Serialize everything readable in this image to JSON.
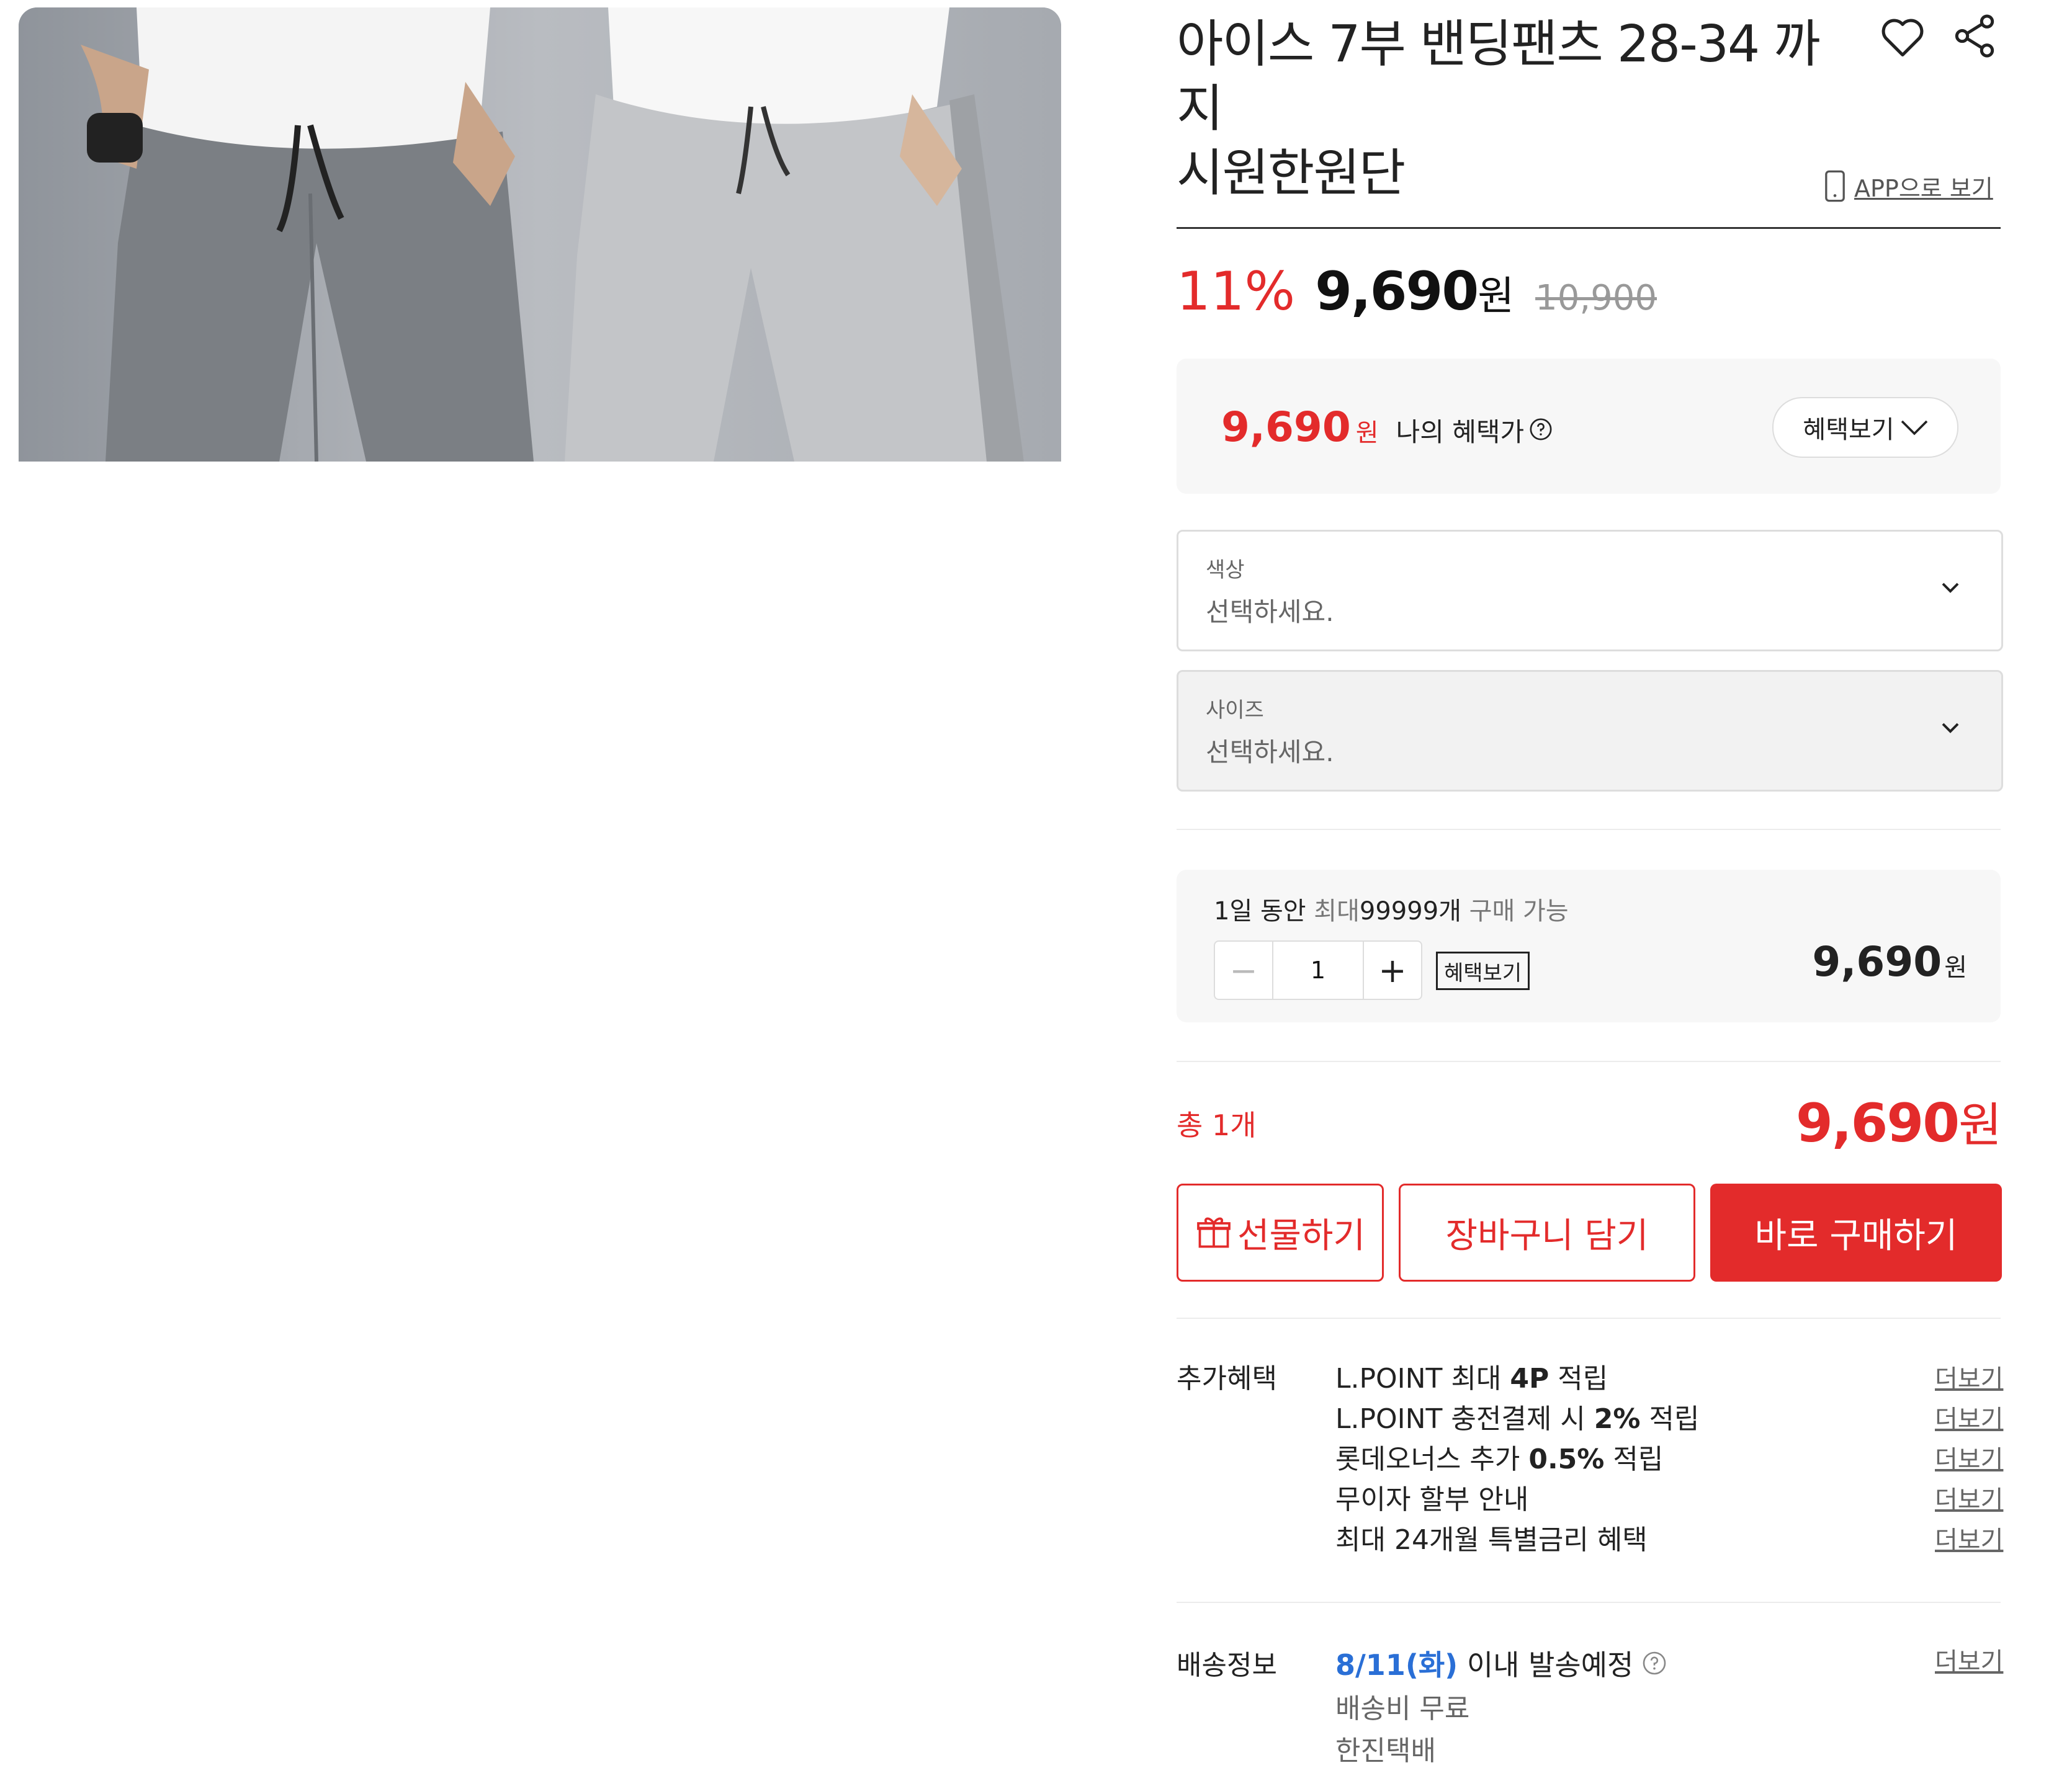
{
  "product": {
    "title_line1": "아이스 7부 밴딩팬츠 28-34 까지",
    "title_line2": "시원한원단",
    "app_link": "APP으로 보기"
  },
  "price": {
    "discount": "11%",
    "sale": "9,690",
    "won": "원",
    "original": "10,900"
  },
  "my_benefit": {
    "price": "9,690",
    "won": "원",
    "label": "나의 혜택가",
    "button": "혜택보기"
  },
  "options": [
    {
      "label": "색상",
      "value": "선택하세요."
    },
    {
      "label": "사이즈",
      "value": "선택하세요."
    }
  ],
  "purchase_limit": {
    "prefix": "1일 동안",
    "middle": "최대",
    "count": "99999개",
    "suffix": "구매 가능"
  },
  "quantity": {
    "minus": "−",
    "value": "1",
    "plus": "+",
    "benefit_label": "혜택보기",
    "line_price": "9,690",
    "won": "원"
  },
  "total": {
    "label": "총 1개",
    "price": "9,690",
    "won": "원"
  },
  "actions": {
    "gift": "선물하기",
    "cart": "장바구니 담기",
    "buy": "바로 구매하기"
  },
  "extra_benefits": {
    "label": "추가혜택",
    "more": "더보기",
    "items": [
      {
        "pre": "L.POINT 최대 ",
        "bold": "4P",
        "post": " 적립"
      },
      {
        "pre": "L.POINT 충전결제 시 ",
        "bold": "2%",
        "post": " 적립"
      },
      {
        "pre": "롯데오너스 추가 ",
        "bold": "0.5%",
        "post": " 적립"
      },
      {
        "pre": "무이자 할부 안내",
        "bold": "",
        "post": ""
      },
      {
        "pre": "최대 24개월 특별금리 혜택",
        "bold": "",
        "post": ""
      }
    ]
  },
  "shipping": {
    "label": "배송정보",
    "date": "8/11(화)",
    "text": "이내 발송예정",
    "fee": "배송비 무료",
    "carrier": "한진택배",
    "more": "더보기"
  },
  "colors": {
    "accent": "#e32b2b",
    "link_blue": "#2a6fd6"
  }
}
